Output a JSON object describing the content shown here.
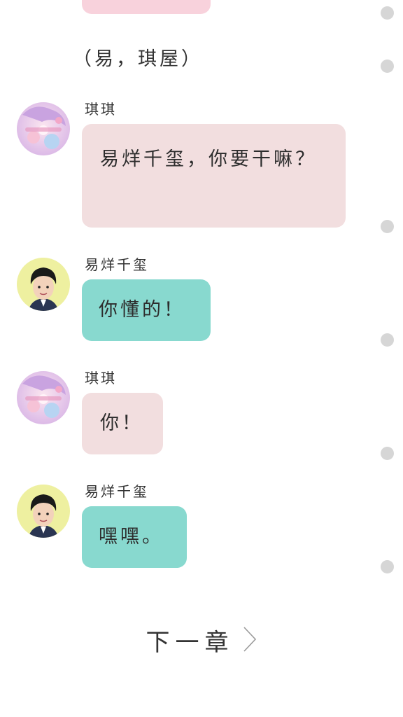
{
  "narration": "（易，琪屋）",
  "messages": [
    {
      "sender": "琪琪",
      "avatar": "anime-girl-avatar",
      "text": "易烊千玺，你要干嘛？",
      "color": "#f2dedf"
    },
    {
      "sender": "易烊千玺",
      "avatar": "boy-photo-avatar",
      "text": "你懂的！",
      "color": "#88d9cf"
    },
    {
      "sender": "琪琪",
      "avatar": "anime-girl-avatar",
      "text": "你！",
      "color": "#f2dedf"
    },
    {
      "sender": "易烊千玺",
      "avatar": "boy-photo-avatar",
      "text": "嘿嘿。",
      "color": "#88d9cf"
    }
  ],
  "footer": {
    "next_chapter_label": "下一章",
    "next_icon": "chevron-right-icon"
  },
  "colors": {
    "pink_bubble": "#f2dedf",
    "teal_bubble": "#88d9cf",
    "top_pink_bubble": "#f8d2dc",
    "scroll_dot": "#d6d6d6"
  }
}
